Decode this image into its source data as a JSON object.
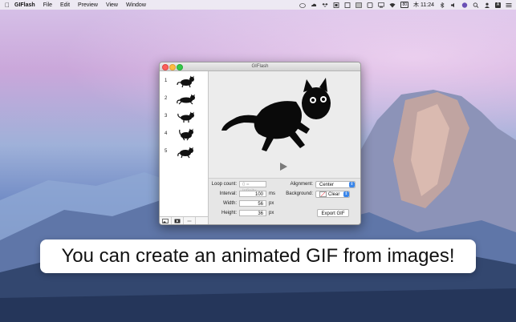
{
  "menubar": {
    "app_name": "GIFlash",
    "menus": [
      "File",
      "Edit",
      "Preview",
      "View",
      "Window"
    ],
    "status_icons": [
      "creative-cloud-icon",
      "cloud-icon",
      "dropbox-icon",
      "grid-icon",
      "square-icon",
      "window-icon",
      "display-icon",
      "wifi-icon",
      "battery-icon"
    ],
    "battery_label": "80",
    "clock": "木 11:24",
    "right_icons": [
      "bluetooth-icon",
      "volume-icon",
      "screen-icon",
      "search-icon",
      "user-icon",
      "input-source-icon",
      "list-icon"
    ],
    "input_source": "A"
  },
  "window": {
    "title": "GIFlash",
    "frames": [
      {
        "number": "1"
      },
      {
        "number": "2"
      },
      {
        "number": "3"
      },
      {
        "number": "4"
      },
      {
        "number": "5"
      }
    ],
    "settings": {
      "loop_count_label": "Loop count:",
      "loop_count_placeholder": "0 = Infinity",
      "interval_label": "Interval:",
      "interval_value": "100",
      "interval_unit": "ms",
      "width_label": "Width:",
      "width_value": "56",
      "width_unit": "px",
      "height_label": "Height:",
      "height_value": "36",
      "height_unit": "px",
      "alignment_label": "Alignment:",
      "alignment_value": "Center",
      "background_label": "Background:",
      "background_value": "Clear",
      "export_label": "Export GIF"
    }
  },
  "caption": "You can create an animated GIF from images!",
  "colors": {
    "close": "#fc605b",
    "minimize": "#fdbc40",
    "zoom": "#34c84a",
    "accent": "#3a86ea"
  }
}
